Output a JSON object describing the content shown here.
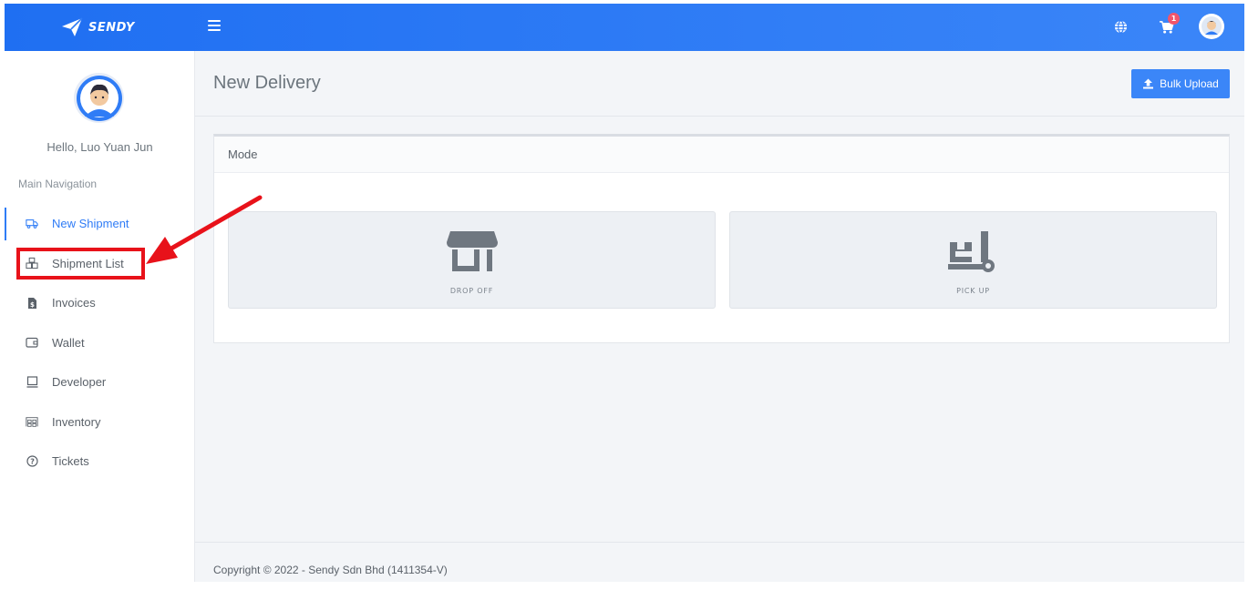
{
  "brand": {
    "name": "SENDY"
  },
  "topbar": {
    "cart_count": "1",
    "icons": [
      "globe-icon",
      "cart-icon",
      "user-avatar"
    ]
  },
  "sidebar": {
    "greeting": "Hello, Luo Yuan Jun",
    "nav_title": "Main Navigation",
    "items": [
      {
        "label": "New Shipment",
        "icon": "truck-icon",
        "active": true
      },
      {
        "label": "Shipment List",
        "icon": "boxes-icon"
      },
      {
        "label": "Invoices",
        "icon": "invoice-icon"
      },
      {
        "label": "Wallet",
        "icon": "wallet-icon"
      },
      {
        "label": "Developer",
        "icon": "laptop-icon"
      },
      {
        "label": "Inventory",
        "icon": "warehouse-icon"
      },
      {
        "label": "Tickets",
        "icon": "help-circle-icon"
      }
    ]
  },
  "main": {
    "title": "New Delivery",
    "bulk_upload_label": "Bulk Upload",
    "card_title": "Mode",
    "options": [
      {
        "label": "DROP OFF",
        "icon": "store-icon"
      },
      {
        "label": "PICK UP",
        "icon": "dolly-icon"
      }
    ]
  },
  "footer": {
    "copyright": "Copyright © 2022 - Sendy Sdn Bhd (1411354-V)"
  },
  "annotation": {
    "color": "#e8121a",
    "target": "Shipment List"
  },
  "colors": {
    "primary": "#2f7cf6",
    "badge": "#f1556c",
    "annotation": "#e8121a"
  }
}
